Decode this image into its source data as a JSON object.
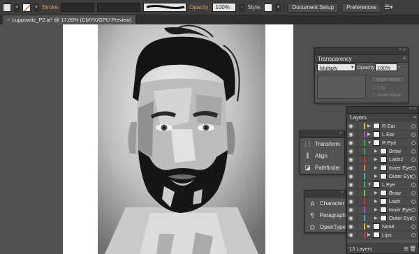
{
  "control_bar": {
    "fill_color": "#e6e6e6",
    "stroke_label": "Stroke",
    "opacity_label": "Opacity:",
    "opacity_value": "100%",
    "style_label": "Style:",
    "document_setup": "Document Setup",
    "preferences": "Preferences"
  },
  "document_tab": {
    "title": "Luppowitz_P2.ai* @ 17.69% (CMYK/GPU Preview)"
  },
  "transparency": {
    "title": "Transparency",
    "blend_mode": "Multiply",
    "opacity_label": "Opacity:",
    "opacity_value": "100%",
    "make_mask": "Make Mask",
    "clip": "Clip",
    "invert_mask": "Invert Mask"
  },
  "transform_group": {
    "items": [
      {
        "label": "Transform",
        "icon": "transform-icon"
      },
      {
        "label": "Align",
        "icon": "align-icon"
      },
      {
        "label": "Pathfinder",
        "icon": "pathfinder-icon"
      }
    ]
  },
  "type_group": {
    "items": [
      {
        "label": "Character",
        "icon": "character-icon"
      },
      {
        "label": "Paragraph",
        "icon": "paragraph-icon"
      },
      {
        "label": "OpenType",
        "icon": "opentype-icon"
      }
    ]
  },
  "layers": {
    "title": "Layers",
    "footer": "13 Layers",
    "rows": [
      {
        "name": "R Ear",
        "color": "#d4c21e",
        "level": 0,
        "expanded": false
      },
      {
        "name": "L Ear",
        "color": "#b24ad8",
        "level": 0,
        "expanded": false
      },
      {
        "name": "R Eye",
        "color": "#31b24a",
        "level": 0,
        "expanded": true
      },
      {
        "name": "Brow",
        "color": "#31b24a",
        "level": 1,
        "expanded": false
      },
      {
        "name": "Lash2",
        "color": "#d6312e",
        "level": 1,
        "expanded": false
      },
      {
        "name": "Inner Eye",
        "color": "#e0862a",
        "level": 1,
        "expanded": false
      },
      {
        "name": "Outer Eye",
        "color": "#3ab0c6",
        "level": 1,
        "expanded": false
      },
      {
        "name": "L Eye",
        "color": "#31b24a",
        "level": 0,
        "expanded": true
      },
      {
        "name": "Brow",
        "color": "#7ac83a",
        "level": 1,
        "expanded": false
      },
      {
        "name": "Lash",
        "color": "#d6312e",
        "level": 1,
        "expanded": false
      },
      {
        "name": "Inner Eye",
        "color": "#b24ad8",
        "level": 1,
        "expanded": false
      },
      {
        "name": "Outer Eye",
        "color": "#3ab0c6",
        "level": 1,
        "expanded": false
      },
      {
        "name": "Nose",
        "color": "#d4c21e",
        "level": 0,
        "expanded": false
      },
      {
        "name": "Lips",
        "color": "#d6312e",
        "level": 0,
        "expanded": false
      }
    ]
  }
}
